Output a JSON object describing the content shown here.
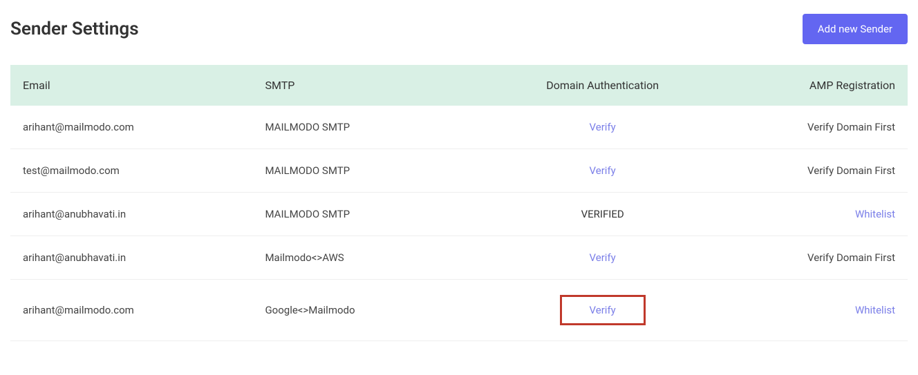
{
  "header": {
    "title": "Sender Settings",
    "add_button_label": "Add new Sender"
  },
  "table": {
    "columns": {
      "email": "Email",
      "smtp": "SMTP",
      "domain": "Domain Authentication",
      "amp": "AMP Registration"
    },
    "rows": [
      {
        "email": "arihant@mailmodo.com",
        "smtp": "MAILMODO SMTP",
        "domain": {
          "text": "Verify",
          "type": "link",
          "highlight": false
        },
        "amp": {
          "text": "Verify Domain First",
          "type": "static"
        }
      },
      {
        "email": "test@mailmodo.com",
        "smtp": "MAILMODO SMTP",
        "domain": {
          "text": "Verify",
          "type": "link",
          "highlight": false
        },
        "amp": {
          "text": "Verify Domain First",
          "type": "static"
        }
      },
      {
        "email": "arihant@anubhavati.in",
        "smtp": "MAILMODO SMTP",
        "domain": {
          "text": "VERIFIED",
          "type": "verified",
          "highlight": false
        },
        "amp": {
          "text": "Whitelist",
          "type": "link"
        }
      },
      {
        "email": "arihant@anubhavati.in",
        "smtp": "Mailmodo<>AWS",
        "domain": {
          "text": "Verify",
          "type": "link",
          "highlight": false
        },
        "amp": {
          "text": "Verify Domain First",
          "type": "static"
        }
      },
      {
        "email": "arihant@mailmodo.com",
        "smtp": "Google<>Mailmodo",
        "domain": {
          "text": "Verify",
          "type": "link",
          "highlight": true
        },
        "amp": {
          "text": "Whitelist",
          "type": "link"
        }
      }
    ]
  }
}
